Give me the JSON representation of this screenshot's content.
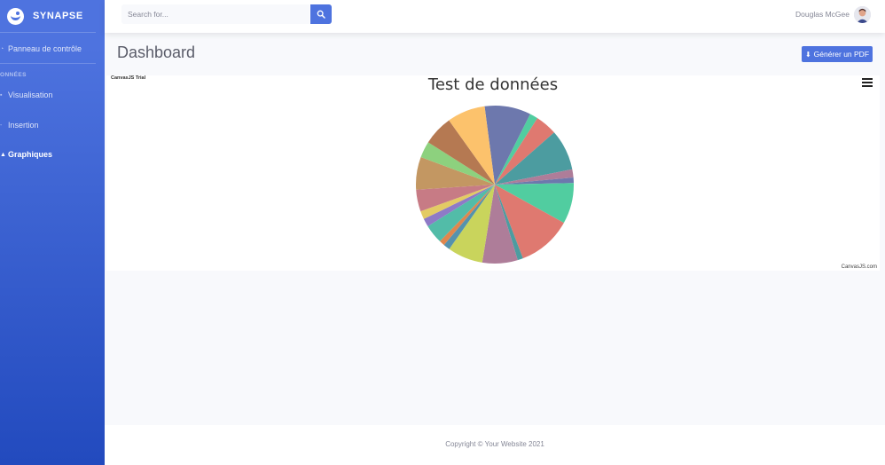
{
  "brand": {
    "name": "SYNAPSE"
  },
  "sidebar": {
    "items": [
      {
        "label": "Panneau de contrôle",
        "icon": "dashboard-icon"
      },
      {
        "label": "Visualisation",
        "icon": "chart-icon"
      },
      {
        "label": "Insertion",
        "icon": "insert-icon"
      },
      {
        "label": "Graphiques",
        "icon": "graph-icon",
        "active": true
      }
    ],
    "section_heading": "ONNÉES"
  },
  "topbar": {
    "search": {
      "placeholder": "Search for..."
    },
    "user": {
      "name": "Douglas McGee"
    }
  },
  "main": {
    "title": "Dashboard",
    "pdf_button": "Générer un PDF"
  },
  "chart": {
    "trial_label": "CanvasJS Trial",
    "credit": "CanvasJS.com"
  },
  "chart_data": {
    "type": "pie",
    "title": "Test de données",
    "slices": [
      {
        "value": 8.5,
        "color": "#6d78ad"
      },
      {
        "value": 1.5,
        "color": "#51cda0"
      },
      {
        "value": 4.0,
        "color": "#df7970"
      },
      {
        "value": 7.5,
        "color": "#4c9ca0"
      },
      {
        "value": 1.5,
        "color": "#ae7d99"
      },
      {
        "value": 1.0,
        "color": "#6d78ad"
      },
      {
        "value": 7.5,
        "color": "#51cda0"
      },
      {
        "value": 10.0,
        "color": "#df7970"
      },
      {
        "value": 1.0,
        "color": "#4c9ca0"
      },
      {
        "value": 6.5,
        "color": "#ae7d99"
      },
      {
        "value": 6.5,
        "color": "#c9d45c"
      },
      {
        "value": 1.2,
        "color": "#5592ad"
      },
      {
        "value": 1.0,
        "color": "#df874d"
      },
      {
        "value": 3.5,
        "color": "#52bca8"
      },
      {
        "value": 1.5,
        "color": "#8e7ac7"
      },
      {
        "value": 1.5,
        "color": "#e3cb64"
      },
      {
        "value": 4.0,
        "color": "#c77b85"
      },
      {
        "value": 6.0,
        "color": "#c39762"
      },
      {
        "value": 3.0,
        "color": "#8dd17e"
      },
      {
        "value": 5.5,
        "color": "#b57952"
      },
      {
        "value": 7.0,
        "color": "#fcc26c"
      }
    ]
  },
  "footer": {
    "text": "Copyright © Your Website 2021"
  },
  "colors": {
    "primary": "#4e73df",
    "sidebar_dark": "#224abe",
    "background": "#f8f9fc"
  }
}
